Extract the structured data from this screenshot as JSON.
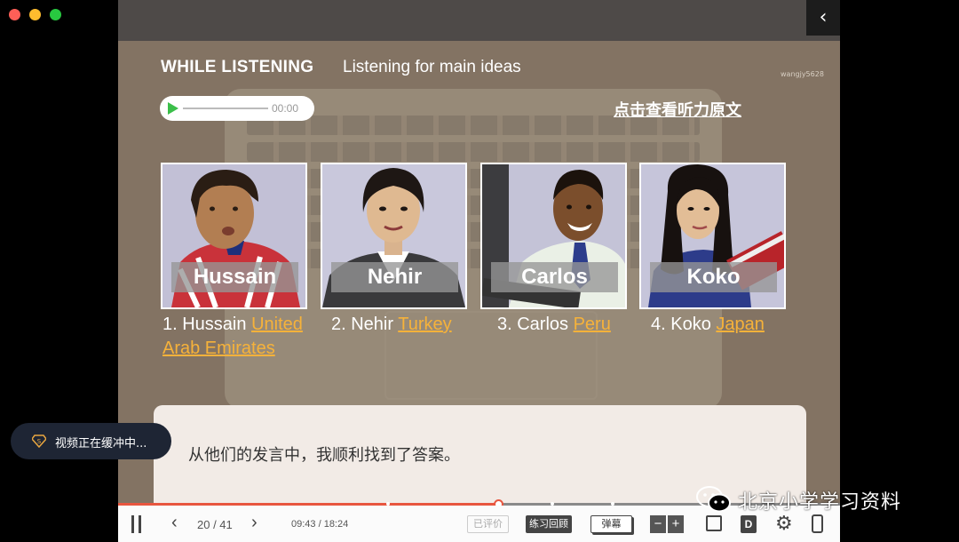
{
  "lesson": {
    "heading": "WHILE LISTENING",
    "subheading": "Listening for main ideas",
    "watermark": "wangjy5628",
    "back_icon": "chevron-left-icon"
  },
  "audio": {
    "time": "00:00",
    "play_icon": "play-icon"
  },
  "transcript_link": "点击查看听力原文",
  "people": [
    {
      "name": "Hussain",
      "number": "1. Hussain ",
      "answer": "United Arab Emirates"
    },
    {
      "name": "Nehir",
      "number": "2. Nehir ",
      "answer": "Turkey"
    },
    {
      "name": "Carlos",
      "number": "3. Carlos ",
      "answer": "Peru"
    },
    {
      "name": "Koko",
      "number": "4. Koko ",
      "answer": "Japan"
    }
  ],
  "subtitle": "从他们的发言中，我顺利找到了答案。",
  "toast": {
    "text": "视频正在缓冲中...",
    "icon": "diamond-badge-icon"
  },
  "player": {
    "page": "20 / 41",
    "time": "09:43 / 18:24",
    "progress": 0.528,
    "rated_label": "已评价",
    "review_label": "练习回顾",
    "danmu_label": "弹幕",
    "minus_label": "−",
    "plus_label": "+",
    "d_label": "D"
  },
  "watermark_brand": "北京小学学习资料",
  "colors": {
    "accent": "#e8563f",
    "answer": "#f6b23a",
    "play": "#3bbf4a"
  }
}
